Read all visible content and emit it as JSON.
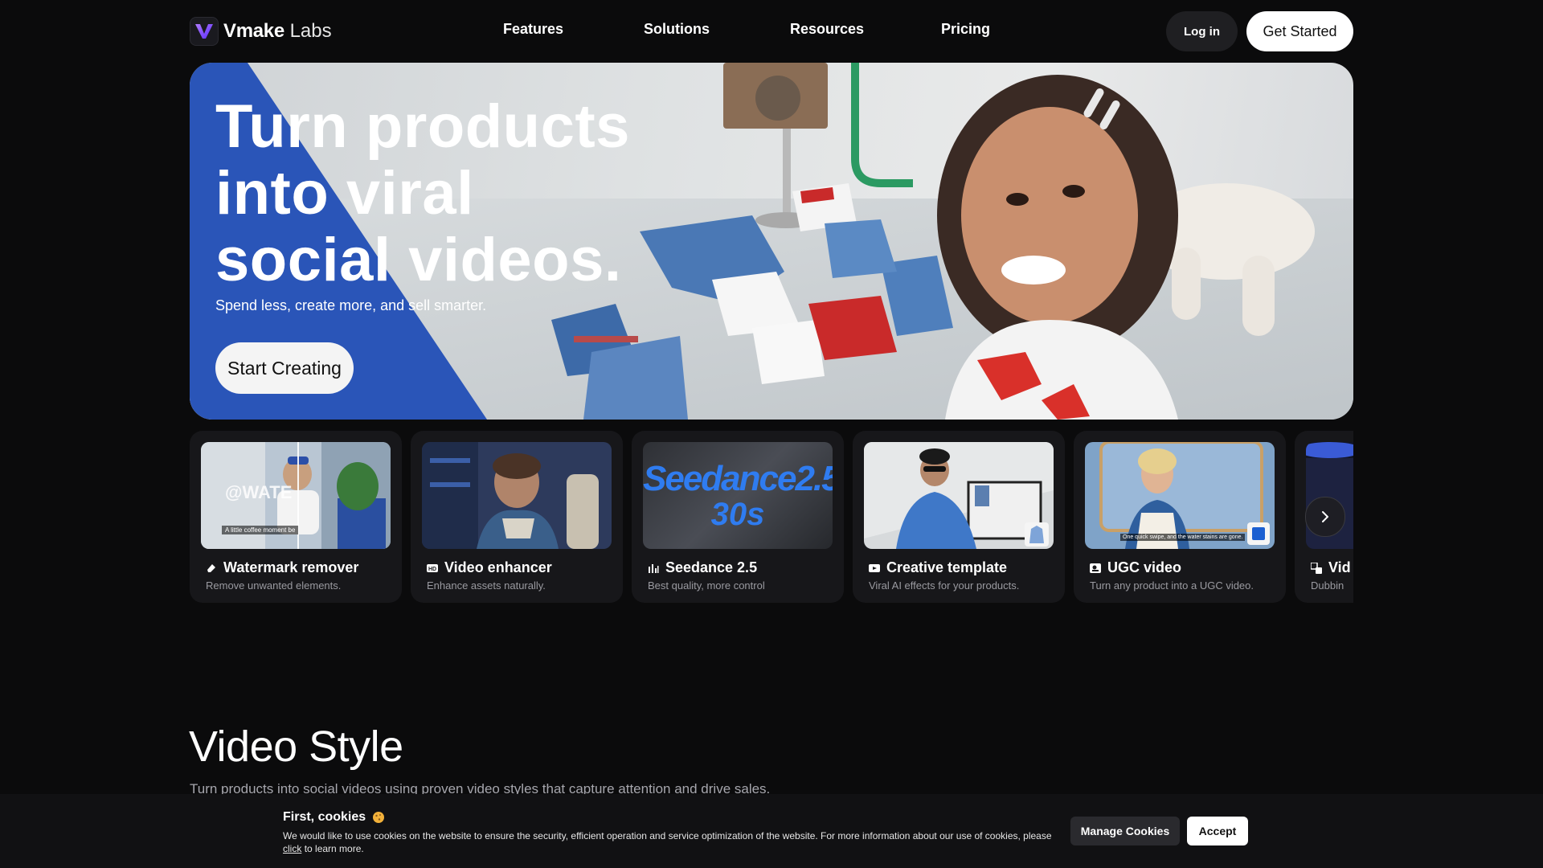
{
  "header": {
    "logo_bold": "Vmake",
    "logo_light": "Labs",
    "nav": [
      "Features",
      "Solutions",
      "Resources",
      "Pricing"
    ],
    "login_label": "Log in",
    "get_started_label": "Get Started"
  },
  "hero": {
    "title": "Turn products\ninto viral\nsocial videos.",
    "subtitle": "Spend less, create more, and sell smarter.",
    "cta_label": "Start Creating"
  },
  "cards": [
    {
      "title": "Watermark remover",
      "desc": "Remove unwanted elements.",
      "icon": "eraser-icon",
      "thumb_overlay": "@WATE",
      "thumb_caption": "A little coffee moment be"
    },
    {
      "title": "Video enhancer",
      "desc": "Enhance assets naturally.",
      "icon": "hd-icon"
    },
    {
      "title": "Seedance 2.5",
      "desc": "Best quality, more control",
      "icon": "bars-icon",
      "thumb_line1": "Seedance2.5",
      "thumb_line2": "30s"
    },
    {
      "title": "Creative template",
      "desc": "Viral AI effects for your products.",
      "icon": "template-icon"
    },
    {
      "title": "UGC video",
      "desc": "Turn any product into a UGC video.",
      "icon": "ugc-icon",
      "thumb_caption": "One quick swipe, and the water stains are gone."
    },
    {
      "title": "Vid",
      "desc": "Dubbin",
      "icon": "translate-icon"
    }
  ],
  "section": {
    "title": "Video Style",
    "subtitle": "Turn products into social videos using proven video styles that capture attention and drive sales."
  },
  "cookie": {
    "title": "First, cookies",
    "text": "We would like to use cookies on the website to ensure the security, efficient operation and service optimization of the website. For more information about our use of cookies, please",
    "link": "click",
    "text_after": "to learn more.",
    "manage_label": "Manage Cookies",
    "accept_label": "Accept"
  },
  "colors": {
    "background": "#0b0b0c",
    "hero_blue": "#2a55b8",
    "accent_purple": "#7a3cff"
  }
}
